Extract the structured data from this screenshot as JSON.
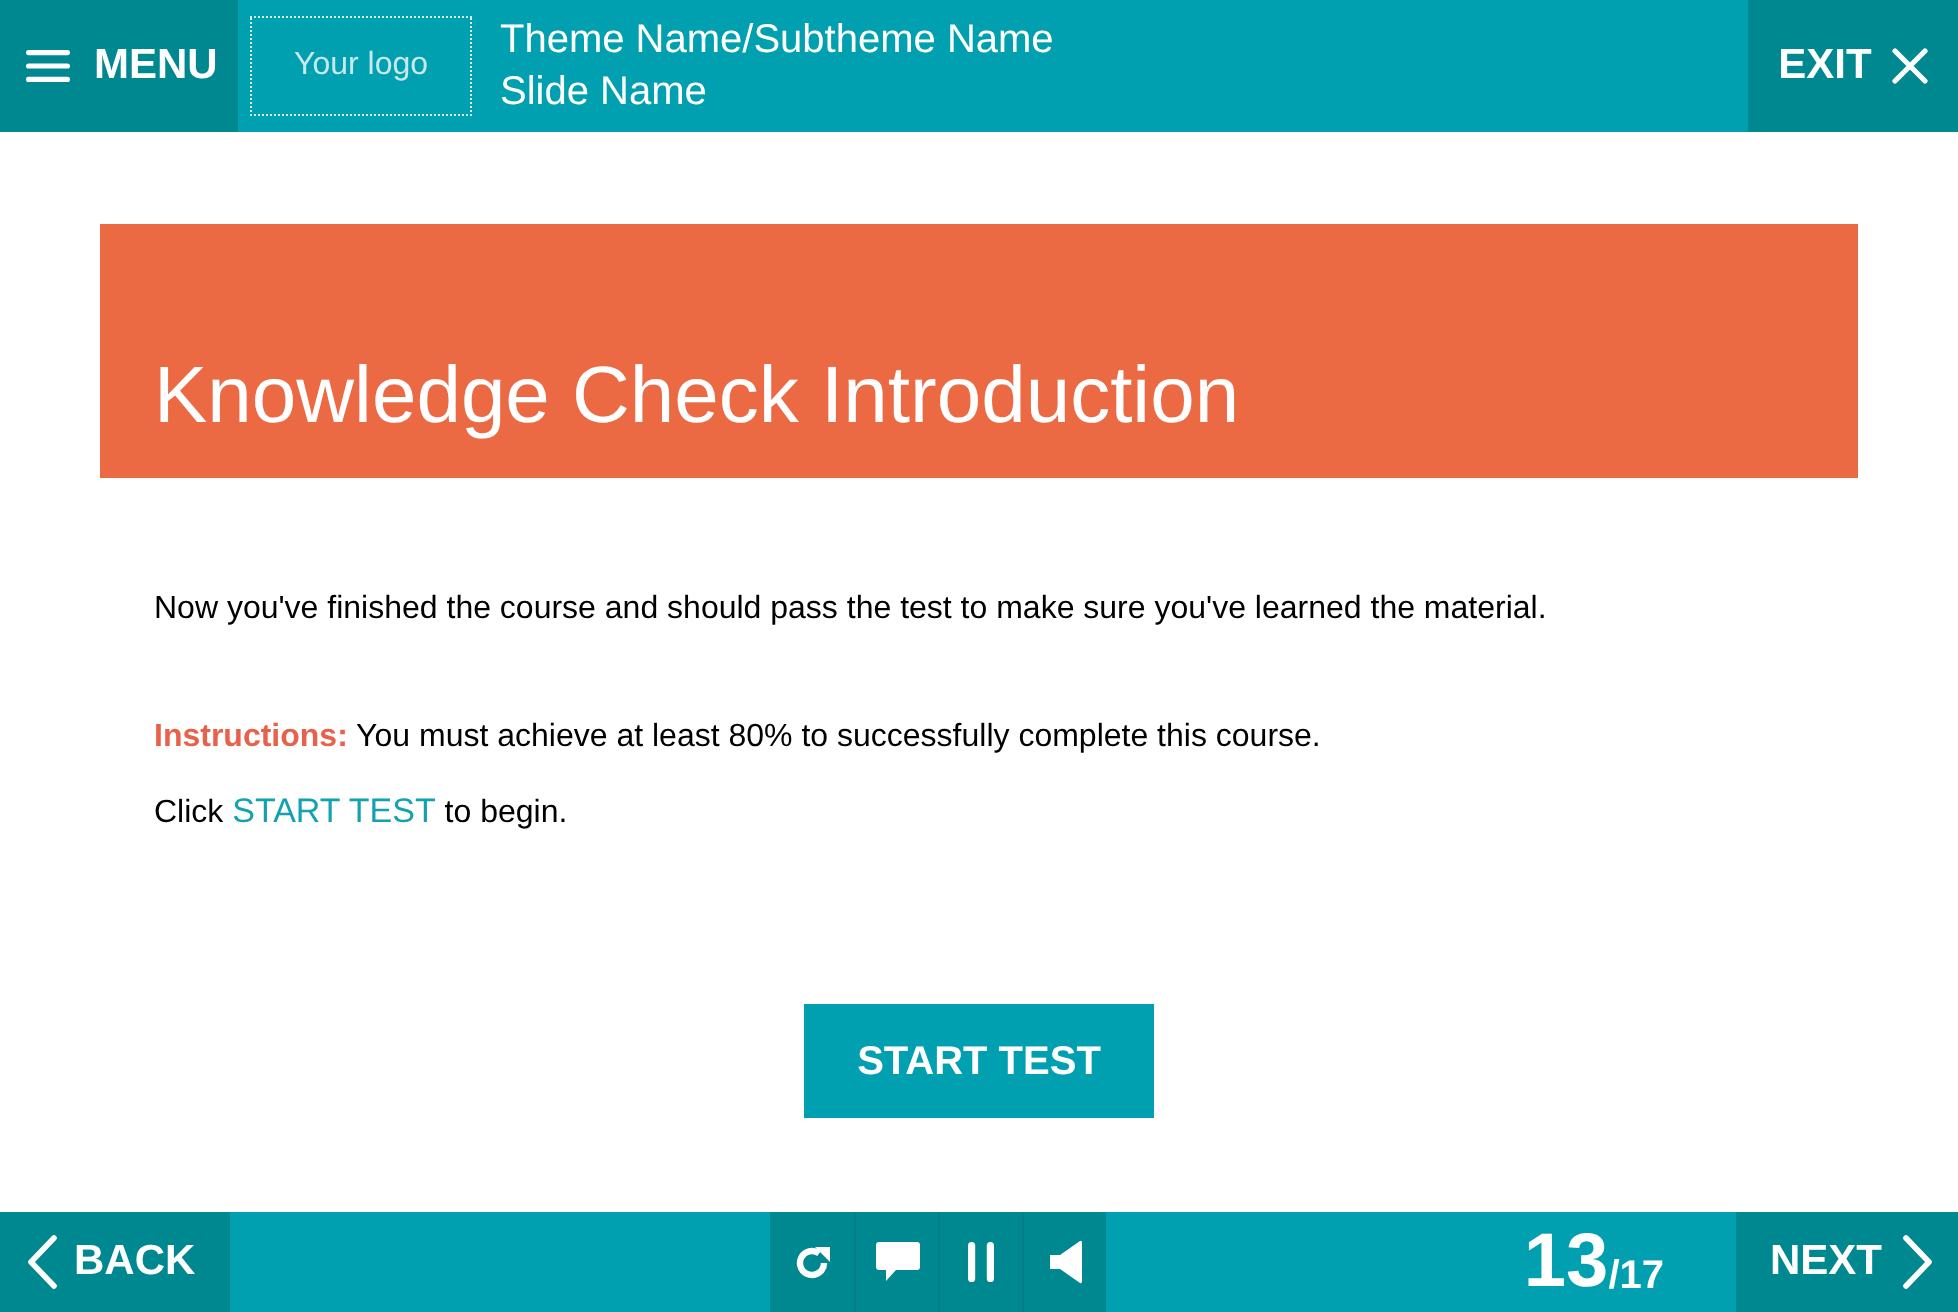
{
  "header": {
    "menu_button": "MENU",
    "logo": "Your logo",
    "theme_title": "Theme Name/Subtheme Name",
    "slide_title": "Slide Name",
    "exit_button": "EXIT"
  },
  "banner": {
    "title": "Knowledge Check Introduction"
  },
  "body": {
    "intro": "Now you've finished the course and should pass the test to make sure you've learned the material.",
    "instructions": {
      "label": "Instructions:",
      "text": "You must achieve at least 80% to successfully complete this course."
    },
    "click_line": {
      "before": "Click",
      "link": "START TEST",
      "after": "to begin."
    },
    "start_button": "START TEST"
  },
  "footer": {
    "back_button": "BACK",
    "page": {
      "current": "13",
      "total": "/17"
    },
    "next_button": "NEXT"
  }
}
